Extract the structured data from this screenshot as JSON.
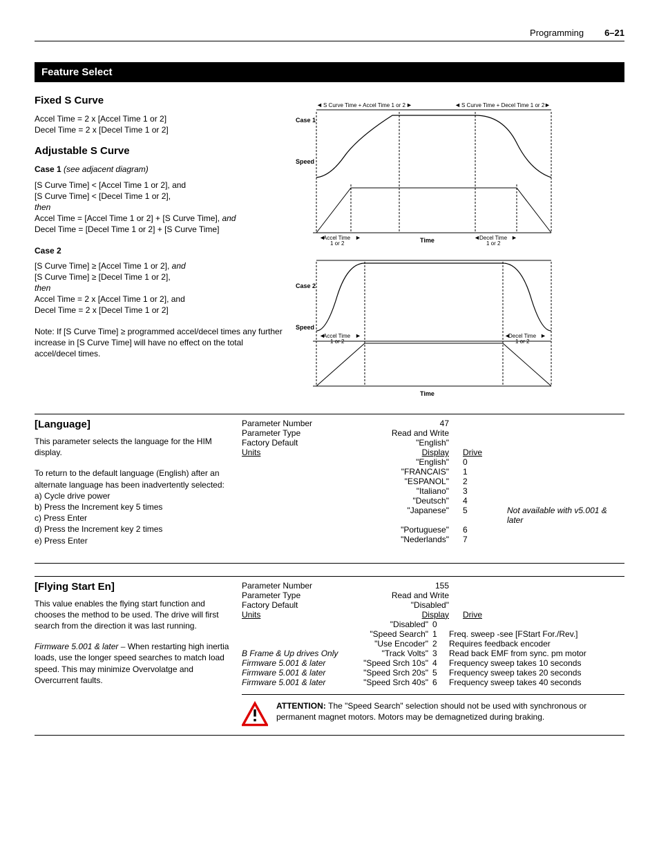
{
  "header": {
    "section": "Programming",
    "page": "6–21"
  },
  "bar": "Feature Select",
  "fixed": {
    "h": "Fixed S Curve",
    "l1": "Accel Time = 2 x [Accel Time 1 or 2]",
    "l2": "Decel Time = 2 x [Decel Time 1 or 2]"
  },
  "adj": {
    "h": "Adjustable S Curve",
    "c1title": "Case 1",
    "c1it": "(see adjacent diagram)",
    "c1a": "[S Curve Time] < [Accel Time 1 or 2], and",
    "c1b": "[S Curve Time] < [Decel Time 1 or 2],",
    "c1then": "then",
    "c1c": "Accel Time = [Accel Time 1 or 2] + [S Curve Time], ",
    "c1and": "and",
    "c1d": "Decel Time = [Decel Time 1 or 2] + [S Curve Time]",
    "c2title": "Case 2",
    "c2a": "[S Curve Time] ≥ [Accel Time 1 or 2], ",
    "c2and": "and",
    "c2b": "[S Curve Time] ≥ [Decel Time 1 or 2],",
    "c2then": "then",
    "c2c": "Accel Time = 2 x [Accel Time 1 or 2], and",
    "c2d": "Decel Time = 2 x [Decel Time 1 or 2]",
    "note": "Note: If [S Curve Time] ≥ programmed accel/decel times any further increase in [S Curve Time] will have no effect on the total accel/decel times."
  },
  "diag": {
    "case1": "Case 1",
    "case2": "Case 2",
    "speed": "Speed",
    "time": "Time",
    "sc_accel": "S Curve Time + Accel Time 1 or 2",
    "sc_decel": "S Curve Time + Decel Time 1 or 2",
    "accel": "Accel Time",
    "decel": "Decel Time",
    "one_or_two": "1 or 2"
  },
  "lang": {
    "title": "[Language]",
    "desc": "This parameter selects the language for the HIM display.",
    "desc2": "To return to the default language (English) after an alternate language has been inadvertently selected:",
    "sa": "a) Cycle drive power",
    "sb": "b) Press the Increment key 5 times",
    "sc": "c) Press Enter",
    "sd": "d) Press the Increment key 2 times",
    "se": "e) Press Enter",
    "m_pn": "Parameter Number",
    "m_pn_v": "47",
    "m_pt": "Parameter Type",
    "m_pt_v": "Read and Write",
    "m_fd": "Factory Default",
    "m_fd_v": "\"English\"",
    "m_u": "Units",
    "m_u_d": "Display",
    "m_u_dr": "Drive",
    "opts": [
      {
        "l": "\"English\"",
        "i": "0",
        "n": ""
      },
      {
        "l": "\"FRANCAIS\"",
        "i": "1",
        "n": ""
      },
      {
        "l": "\"ESPANOL\"",
        "i": "2",
        "n": ""
      },
      {
        "l": "\"Italiano\"",
        "i": "3",
        "n": ""
      },
      {
        "l": "\"Deutsch\"",
        "i": "4",
        "n": ""
      },
      {
        "l": "\"Japanese\"",
        "i": "5",
        "n": "Not available with v5.001 & later"
      },
      {
        "l": "\"Portuguese\"",
        "i": "6",
        "n": ""
      },
      {
        "l": "\"Nederlands\"",
        "i": "7",
        "n": ""
      }
    ]
  },
  "fly": {
    "title": "[Flying Start En]",
    "desc": "This value enables the flying start function and chooses the method to be used. The drive will first search from the direction it was last running.",
    "fw": "Firmware 5.001 & later – ",
    "desc2": "When restarting high inertia loads, use the longer speed searches to match load speed. This may minimize Overvolatge and Overcurrent faults.",
    "m_pn": "Parameter Number",
    "m_pn_v": "155",
    "m_pt": "Parameter Type",
    "m_pt_v": "Read and Write",
    "m_fd": "Factory Default",
    "m_fd_v": "\"Disabled\"",
    "m_u": "Units",
    "m_u_d": "Display",
    "m_u_dr": "Drive",
    "rows": [
      {
        "left": "",
        "mid": "\"Disabled\"",
        "i": "0",
        "right": ""
      },
      {
        "left": "",
        "mid": "\"Speed Search\"",
        "i": "1",
        "right": "Freq. sweep -see [FStart For./Rev.]"
      },
      {
        "left": "",
        "mid": "\"Use Encoder\"",
        "i": "2",
        "right": "Requires feedback encoder"
      },
      {
        "left": "B Frame & Up drives Only",
        "mid": "\"Track Volts\"",
        "i": "3",
        "right": "Read back EMF from sync. pm motor"
      },
      {
        "left": "Firmware 5.001 & later",
        "mid": "\"Speed Srch 10s\"",
        "i": "4",
        "right": "Frequency sweep takes 10 seconds"
      },
      {
        "left": "Firmware 5.001 & later",
        "mid": "\"Speed Srch 20s\"",
        "i": "5",
        "right": "Frequency sweep takes 20 seconds"
      },
      {
        "left": "Firmware 5.001 & later",
        "mid": "\"Speed Srch 40s\"",
        "i": "6",
        "right": "Frequency sweep takes 40 seconds"
      }
    ],
    "attn_b": "ATTENTION:  ",
    "attn": "The \"Speed Search\" selection should not be used with synchronous or permanent magnet motors. Motors may be demagnetized during braking."
  }
}
